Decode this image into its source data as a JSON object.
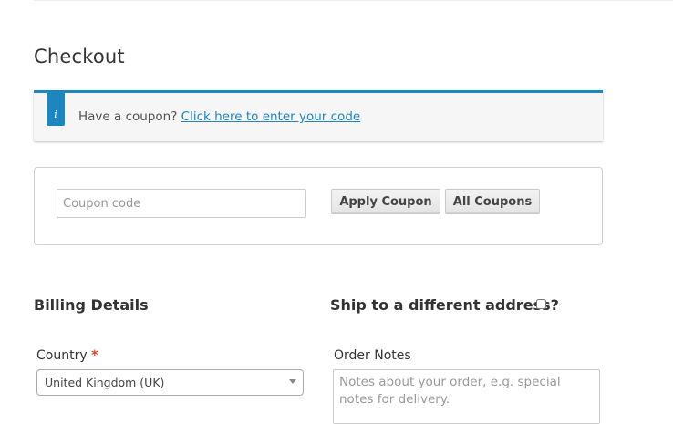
{
  "page": {
    "title": "Checkout"
  },
  "coupon_notice": {
    "prefix": "Have a coupon?",
    "link_text": "Click here to enter your code",
    "icon": "info-icon",
    "icon_glyph": "i",
    "accent_color": "#1e85be"
  },
  "coupon_form": {
    "placeholder": "Coupon code",
    "value": "",
    "apply_label": "Apply Coupon",
    "all_label": "All Coupons"
  },
  "billing": {
    "heading": "Billing Details",
    "country_label": "Country",
    "required_mark": "*",
    "country_value": "United Kingdom (UK)"
  },
  "shipping": {
    "heading": "Ship to a different address?",
    "checked": false
  },
  "order_notes": {
    "label": "Order Notes",
    "placeholder": "Notes about your order, e.g. special notes for delivery."
  }
}
